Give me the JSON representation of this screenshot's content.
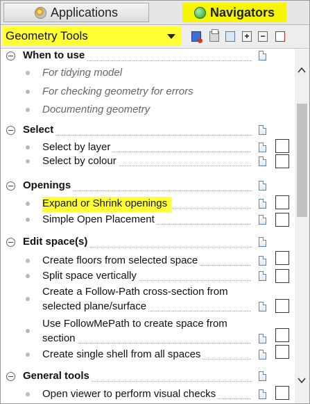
{
  "tabs": {
    "applications": "Applications",
    "navigators": "Navigators"
  },
  "toolbar": {
    "combo_value": "Geometry Tools",
    "icons": [
      "refresh-icon",
      "print-icon",
      "copy-icon",
      "expand-all-icon",
      "collapse-all-icon",
      "close-icon"
    ],
    "expand_glyph": "+",
    "collapse_glyph": "−"
  },
  "sections": [
    {
      "title": "When to use",
      "items": [
        {
          "label": "For tidying model",
          "style": "italic",
          "checkbox": false
        },
        {
          "label": "For checking geometry for errors",
          "style": "italic",
          "checkbox": false
        },
        {
          "label": "Documenting geometry",
          "style": "italic",
          "checkbox": false
        }
      ]
    },
    {
      "title": "Select",
      "items": [
        {
          "label": "Select by layer",
          "checkbox": true
        },
        {
          "label": "Select by colour",
          "checkbox": true
        }
      ]
    },
    {
      "title": "Openings",
      "items": [
        {
          "label": "Expand or Shrink openings",
          "highlighted": true,
          "checkbox": true
        },
        {
          "label": "Simple Open Placement",
          "checkbox": true
        }
      ]
    },
    {
      "title": "Edit space(s)",
      "items": [
        {
          "label": "Create floors from selected space",
          "checkbox": true
        },
        {
          "label": "Split space vertically",
          "checkbox": true
        },
        {
          "label_lines": [
            "Create a Follow-Path cross-section from",
            "selected plane/surface"
          ],
          "checkbox": true
        },
        {
          "label_lines": [
            "Use FollowMePath to create space from",
            "section"
          ],
          "checkbox": true
        },
        {
          "label": "Create single shell from all spaces",
          "checkbox": true
        }
      ]
    },
    {
      "title": "General tools",
      "items": [
        {
          "label": "Open viewer to perform visual checks",
          "checkbox": true
        }
      ]
    }
  ],
  "colors": {
    "highlight": "#ffff33",
    "tab_bar": "#e6e6e6"
  }
}
